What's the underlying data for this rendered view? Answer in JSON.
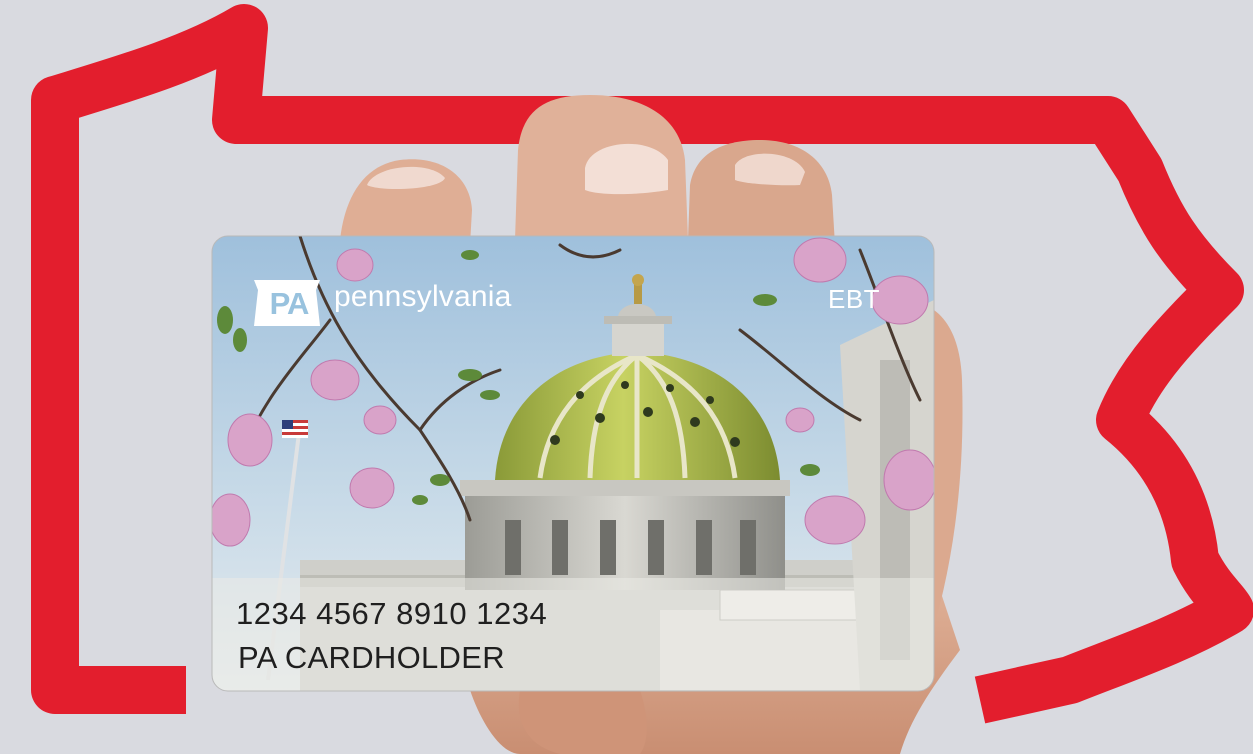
{
  "card": {
    "state_logo_abbr": "PA",
    "state_name": "pennsylvania",
    "card_type": "EBT",
    "card_number": "1234 4567 8910 1234",
    "cardholder": "PA CARDHOLDER"
  },
  "colors": {
    "outline_red": "#e31e2d",
    "background": "#d9dae0",
    "sky": "#b9d3e6",
    "dome_green": "#a9b94a"
  }
}
